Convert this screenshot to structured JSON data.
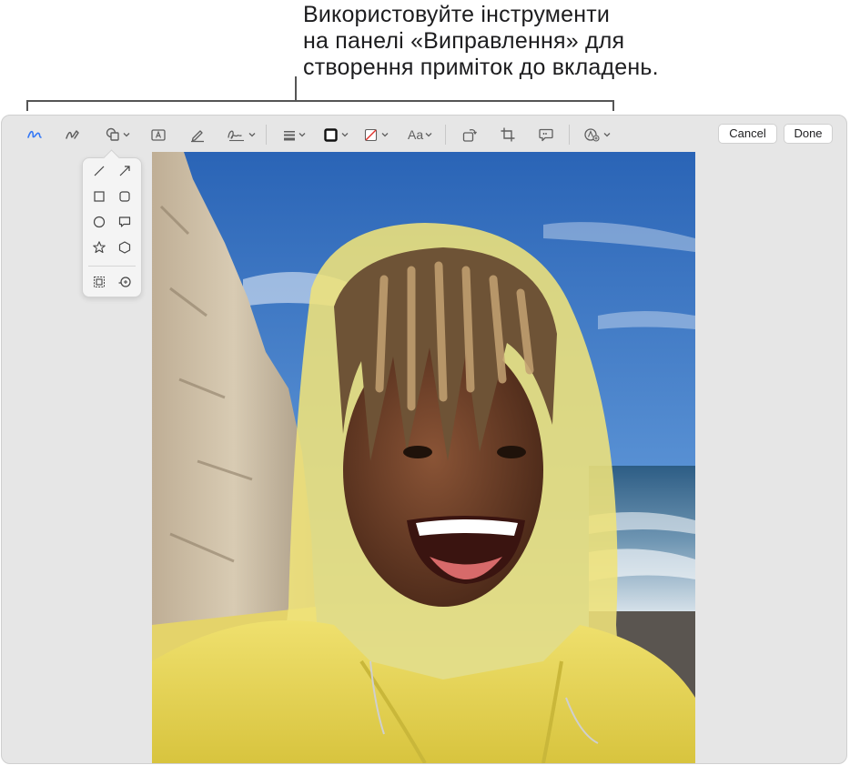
{
  "callout": {
    "lines": [
      "Використовуйте інструменти",
      "на панелі «Виправлення» для",
      "створення приміток до вкладень."
    ]
  },
  "toolbar": {
    "tools": [
      "sketch-icon",
      "draw-icon",
      "shapes-icon",
      "text-icon",
      "highlight-icon",
      "sign-icon",
      "shape-style-icon",
      "border-color-icon",
      "fill-color-icon",
      "text-style-icon",
      "rotate-icon",
      "crop-icon",
      "description-icon",
      "markup-options-icon"
    ],
    "cancel_label": "Cancel",
    "done_label": "Done",
    "text_style_label": "Aa",
    "accent_color": "#3478f6"
  },
  "shapes_popover": {
    "items": [
      "line-icon",
      "arrow-icon",
      "rectangle-icon",
      "rounded-rectangle-icon",
      "oval-icon",
      "speech-bubble-icon",
      "star-icon",
      "polygon-icon",
      "mask-icon",
      "loupe-icon"
    ]
  }
}
